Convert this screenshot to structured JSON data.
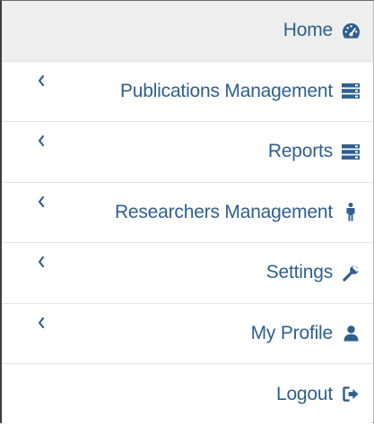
{
  "nav": {
    "items": [
      {
        "label": "Home",
        "icon": "dashboard-icon",
        "expandable": false,
        "active": true
      },
      {
        "label": "Publications Management",
        "icon": "server-icon",
        "expandable": true,
        "active": false
      },
      {
        "label": "Reports",
        "icon": "server-icon",
        "expandable": true,
        "active": false
      },
      {
        "label": "Researchers Management",
        "icon": "male-figure-icon",
        "expandable": true,
        "active": false
      },
      {
        "label": "Settings",
        "icon": "wrench-icon",
        "expandable": true,
        "active": false
      },
      {
        "label": "My Profile",
        "icon": "user-icon",
        "expandable": true,
        "active": false
      },
      {
        "label": "Logout",
        "icon": "sign-out-icon",
        "expandable": false,
        "active": false
      }
    ]
  },
  "colors": {
    "text": "#2f5f8f",
    "active_background": "#eeeeee",
    "divider": "#e4e4e4"
  }
}
